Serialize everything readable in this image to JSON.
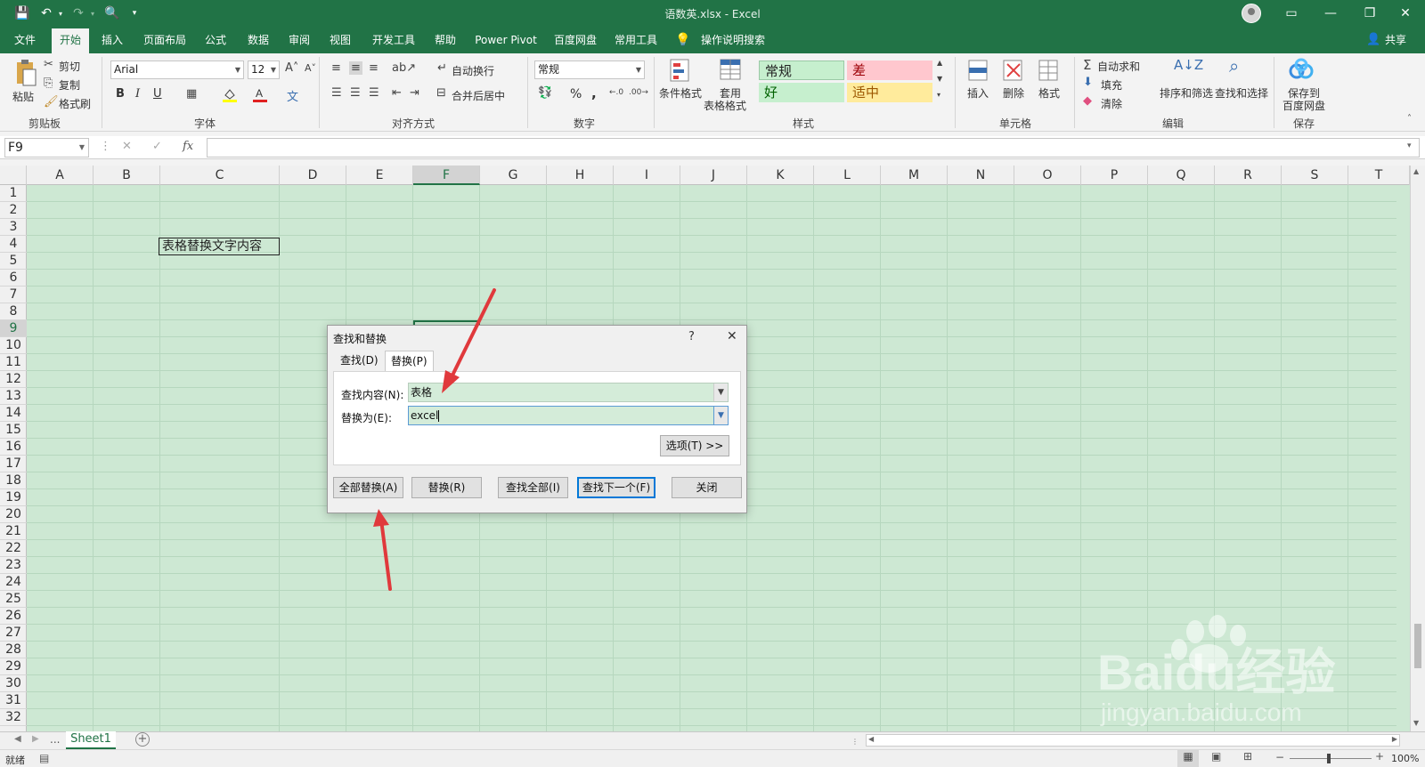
{
  "app": {
    "window_title": "语数英.xlsx  -  Excel",
    "share_label": "共享"
  },
  "menu": {
    "tabs": [
      "文件",
      "开始",
      "插入",
      "页面布局",
      "公式",
      "数据",
      "审阅",
      "视图",
      "开发工具",
      "帮助",
      "Power Pivot",
      "百度网盘",
      "常用工具"
    ],
    "search_label": "操作说明搜索",
    "active_tab": "开始"
  },
  "ribbon": {
    "clipboard": {
      "paste": "粘贴",
      "cut": "剪切",
      "copy": "复制",
      "format_painter": "格式刷",
      "group_label": "剪贴板"
    },
    "font": {
      "font_name": "Arial",
      "font_size": "12",
      "group_label": "字体",
      "bold": "B",
      "italic": "I",
      "underline": "U"
    },
    "alignment": {
      "wrap_text": "自动换行",
      "merge_center": "合并后居中",
      "group_label": "对齐方式"
    },
    "number": {
      "format": "常规",
      "group_label": "数字",
      "percent": "%",
      "comma": ","
    },
    "styles": {
      "conditional_format": "条件格式",
      "table_format_1": "套用",
      "table_format_2": "表格格式",
      "normal": "常规",
      "bad": "差",
      "good": "好",
      "neutral": "适中",
      "group_label": "样式"
    },
    "cells": {
      "insert": "插入",
      "delete": "删除",
      "format": "格式",
      "group_label": "单元格"
    },
    "editing": {
      "autosum": "自动求和",
      "fill": "填充",
      "clear": "清除",
      "sort_filter": "排序和筛选",
      "find_select": "查找和选择",
      "group_label": "编辑"
    },
    "save": {
      "save_to_1": "保存到",
      "save_to_2": "百度网盘",
      "group_label": "保存"
    }
  },
  "formula_bar": {
    "name_box": "F9",
    "fx": "fx",
    "value": ""
  },
  "grid": {
    "columns": [
      "A",
      "B",
      "C",
      "D",
      "E",
      "F",
      "G",
      "H",
      "I",
      "J",
      "K",
      "L",
      "M",
      "N",
      "O",
      "P",
      "Q",
      "R",
      "S",
      "T"
    ],
    "rows": [
      "1",
      "2",
      "3",
      "4",
      "5",
      "6",
      "7",
      "8",
      "9",
      "10",
      "11",
      "12",
      "13",
      "14",
      "15",
      "16",
      "17",
      "18",
      "19",
      "20",
      "21",
      "22",
      "23",
      "24",
      "25",
      "26",
      "27",
      "28",
      "29",
      "30",
      "31",
      "32"
    ],
    "selected_cell": "F9",
    "cell_c4": "表格替换文字内容"
  },
  "dialog": {
    "title": "查找和替换",
    "help": "?",
    "close": "✕",
    "tab_find": "查找(D)",
    "tab_replace": "替换(P)",
    "find_label": "查找内容(N):",
    "find_value": "表格",
    "replace_label": "替换为(E):",
    "replace_value": "excel",
    "options_button": "选项(T) >>",
    "replace_all": "全部替换(A)",
    "replace": "替换(R)",
    "find_all": "查找全部(I)",
    "find_next": "查找下一个(F)",
    "close_button": "关闭"
  },
  "sheets": {
    "nav_more": "...",
    "active": "Sheet1"
  },
  "status": {
    "mode": "就绪",
    "zoom": "100%"
  },
  "watermark": {
    "brand": "Baidu经验",
    "url": "jingyan.baidu.com"
  },
  "colors": {
    "excel_green": "#217346",
    "grid_bg": "#cde8d3",
    "arrow_red": "#e0393c",
    "bad_bg": "#ffc7ce",
    "good_bg": "#c6efce",
    "neutral_bg": "#ffeb9c"
  }
}
